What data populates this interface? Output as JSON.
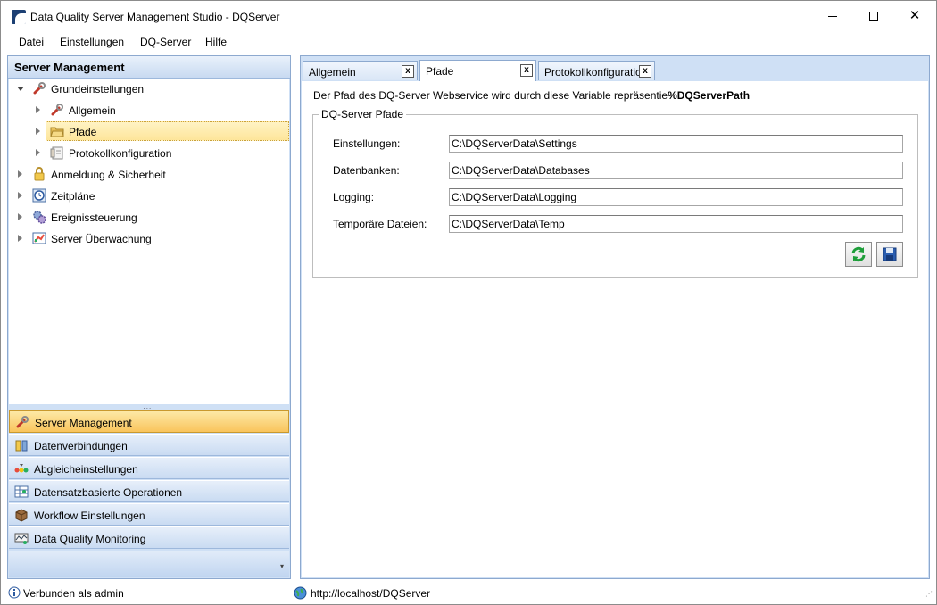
{
  "window": {
    "title": "Data Quality Server Management Studio - DQServer",
    "min_glyph": "",
    "close_glyph": "✕"
  },
  "menu": {
    "items": [
      "Datei",
      "Einstellungen",
      "DQ-Server",
      "Hilfe"
    ]
  },
  "left_panel": {
    "header": "Server Management",
    "tree": [
      {
        "label": "Grundeinstellungen",
        "icon": "wrench-icon"
      },
      {
        "label": "Allgemein",
        "icon": "wrench-icon"
      },
      {
        "label": "Pfade",
        "icon": "folder-icon"
      },
      {
        "label": "Protokollkonfiguration",
        "icon": "log-icon"
      },
      {
        "label": "Anmeldung & Sicherheit",
        "icon": "lock-icon"
      },
      {
        "label": "Zeitpläne",
        "icon": "clock-icon"
      },
      {
        "label": "Ereignissteuerung",
        "icon": "gears-icon"
      },
      {
        "label": "Server Überwachung",
        "icon": "monitor-chart-icon"
      }
    ],
    "splitter_glyph": "....",
    "nav": [
      {
        "label": "Server Management",
        "icon": "wrench-icon"
      },
      {
        "label": "Datenverbindungen",
        "icon": "database-icon"
      },
      {
        "label": "Abgleicheinstellungen",
        "icon": "match-icon"
      },
      {
        "label": "Datensatzbasierte Operationen",
        "icon": "table-icon"
      },
      {
        "label": "Workflow Einstellungen",
        "icon": "box-icon"
      },
      {
        "label": "Data Quality Monitoring",
        "icon": "monitoring-icon"
      }
    ],
    "footer_glyph": "▾"
  },
  "tabs": [
    {
      "label": "Allgemein",
      "close": "x"
    },
    {
      "label": "Pfade",
      "close": "x"
    },
    {
      "label": "Protokollkonfiguration",
      "close": "x"
    }
  ],
  "content": {
    "intro_text": "Der Pfad des DQ-Server Webservice wird durch diese Variable repräsentie",
    "intro_variable": "%DQServerPath",
    "group_title": "DQ-Server Pfade",
    "fields": [
      {
        "label": "Einstellungen:",
        "value": "C:\\DQServerData\\Settings"
      },
      {
        "label": "Datenbanken:",
        "value": "C:\\DQServerData\\Databases"
      },
      {
        "label": "Logging:",
        "value": "C:\\DQServerData\\Logging"
      },
      {
        "label": "Temporäre Dateien:",
        "value": "C:\\DQServerData\\Temp"
      }
    ]
  },
  "status": {
    "connection": "Verbunden als admin",
    "url": "http://localhost/DQServer",
    "grip_glyph": "⋰"
  },
  "colors": {
    "panel_bg": "#cfe0f5",
    "selection": "#fde59a",
    "active_nav": "#f9c45c"
  }
}
